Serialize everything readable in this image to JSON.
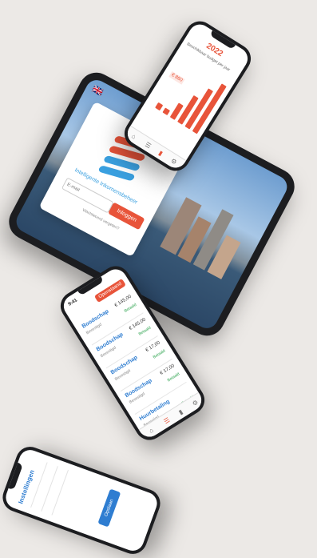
{
  "tablet": {
    "language_icon": "uk-flag-icon",
    "brand_name": "Intelligente Inkomensbeheer",
    "username_placeholder": "E-mail",
    "login_label": "Inloggen",
    "forgot_label": "Wachtwoord vergeten?",
    "brand_colors": [
      "#e8543a",
      "#3aa0e0"
    ]
  },
  "phone_top": {
    "year": "2022",
    "subtitle": "Beschikbaar budget per jaar",
    "bar_values": [
      0.12,
      0.1,
      0.3,
      0.55,
      0.8,
      1.0
    ],
    "highlight_value": "€ 860"
  },
  "phone_mid": {
    "time": "9:41",
    "badge_label": "Openstaand",
    "rows": [
      {
        "title": "Boodschap",
        "sub": "Bevestigd",
        "amount": "€ 145,00",
        "status": "Betaald"
      },
      {
        "title": "Boodschap",
        "sub": "Bevestigd",
        "amount": "€ 145,00",
        "status": "Betaald"
      },
      {
        "title": "Boodschap",
        "sub": "Bevestigd",
        "amount": "€ 17,00",
        "status": "Betaald"
      },
      {
        "title": "Boodschap",
        "sub": "Bevestigd",
        "amount": "€ 17,00",
        "status": "Betaald"
      },
      {
        "title": "Huurbetaling",
        "sub": "Bevestigd",
        "amount": "",
        "status": "Betaald"
      }
    ]
  },
  "phone_bot": {
    "title": "Instellingen",
    "button_label": "Opslaan"
  }
}
